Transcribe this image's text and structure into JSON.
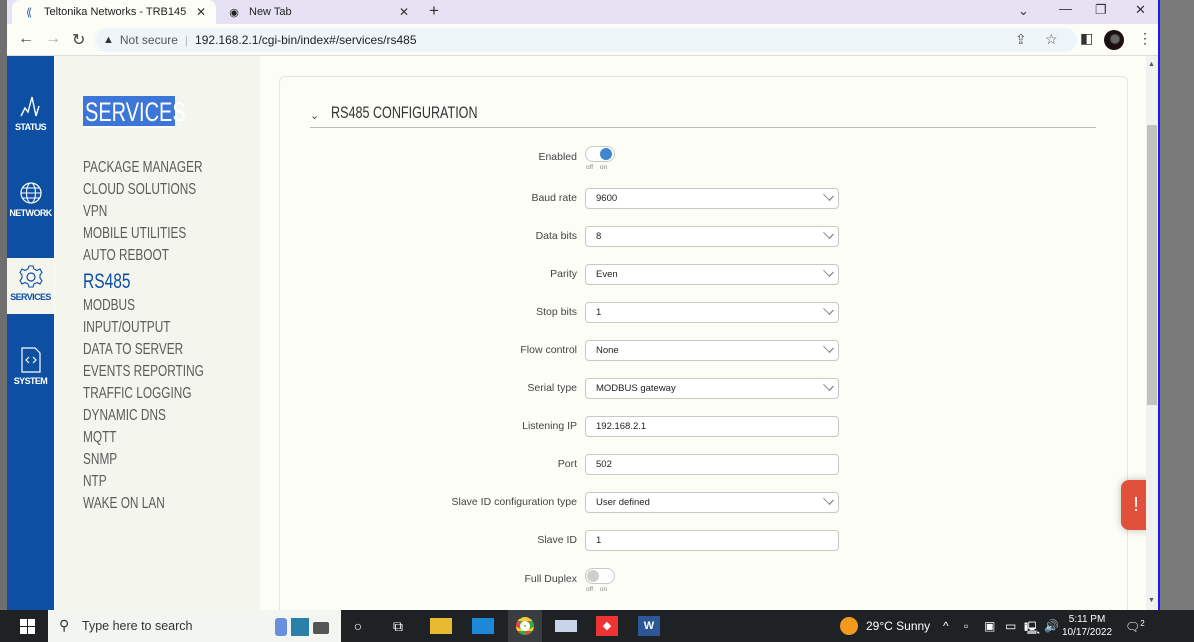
{
  "browser": {
    "tabs": [
      {
        "title": "Teltonika Networks - TRB145",
        "icon": "teltonika-icon",
        "active": true
      },
      {
        "title": "New Tab",
        "icon": "chrome-icon",
        "active": false
      }
    ],
    "not_secure_label": "Not secure",
    "url": "192.168.2.1/cgi-bin/index#/services/rs485"
  },
  "rail": {
    "items": [
      {
        "label": "STATUS",
        "icon": "status-wave-icon"
      },
      {
        "label": "NETWORK",
        "icon": "globe-icon"
      },
      {
        "label": "SERVICES",
        "icon": "gear-icon",
        "active": true
      },
      {
        "label": "SYSTEM",
        "icon": "code-file-icon"
      }
    ],
    "color": "#0c4fa3"
  },
  "menu": {
    "title": "SERVICES",
    "items": [
      "PACKAGE MANAGER",
      "CLOUD SOLUTIONS",
      "VPN",
      "MOBILE UTILITIES",
      "AUTO REBOOT",
      "RS485",
      "MODBUS",
      "INPUT/OUTPUT",
      "DATA TO SERVER",
      "EVENTS REPORTING",
      "TRAFFIC LOGGING",
      "DYNAMIC DNS",
      "MQTT",
      "SNMP",
      "NTP",
      "WAKE ON LAN"
    ],
    "active": "RS485"
  },
  "form": {
    "section_title": "RS485 CONFIGURATION",
    "toggle_off": "off",
    "toggle_on": "on",
    "enabled": {
      "label": "Enabled",
      "value": true
    },
    "baud_rate": {
      "label": "Baud rate",
      "value": "9600"
    },
    "data_bits": {
      "label": "Data bits",
      "value": "8"
    },
    "parity": {
      "label": "Parity",
      "value": "Even"
    },
    "stop_bits": {
      "label": "Stop bits",
      "value": "1"
    },
    "flow_control": {
      "label": "Flow control",
      "value": "None"
    },
    "serial_type": {
      "label": "Serial type",
      "value": "MODBUS gateway"
    },
    "listening_ip": {
      "label": "Listening IP",
      "value": "192.168.2.1"
    },
    "port": {
      "label": "Port",
      "value": "502"
    },
    "slave_id_type": {
      "label": "Slave ID configuration type",
      "value": "User defined"
    },
    "slave_id": {
      "label": "Slave ID",
      "value": "1"
    },
    "full_duplex": {
      "label": "Full Duplex",
      "value": false
    }
  },
  "alert_label": "!",
  "alert_color": "#e0503a",
  "taskbar": {
    "search_placeholder": "Type here to search",
    "weather": "29°C  Sunny",
    "time": "5:11 PM",
    "date": "10/17/2022",
    "notifications": "2"
  }
}
